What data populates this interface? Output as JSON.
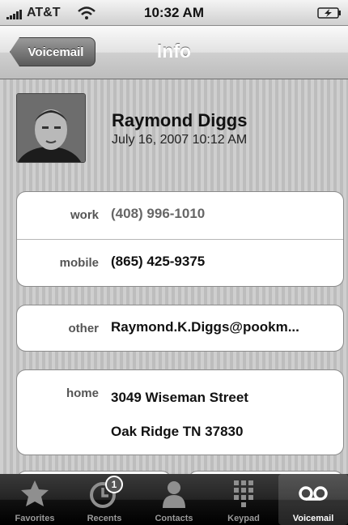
{
  "status": {
    "carrier": "AT&T",
    "time": "10:32 AM"
  },
  "nav": {
    "back_label": "Voicemail",
    "title": "Info"
  },
  "contact": {
    "name": "Raymond Diggs",
    "date": "July 16, 2007 10:12 AM"
  },
  "phones": [
    {
      "label": "work",
      "value": "(408) 996-1010"
    },
    {
      "label": "mobile",
      "value": "(865) 425-9375"
    }
  ],
  "email": {
    "label": "other",
    "value": "Raymond.K.Diggs@pookm..."
  },
  "address": {
    "label": "home",
    "line1": "3049 Wiseman Street",
    "line2": "Oak Ridge TN 37830"
  },
  "tabs": [
    {
      "label": "Favorites",
      "icon": "star-icon"
    },
    {
      "label": "Recents",
      "icon": "clock-icon",
      "badge": "1"
    },
    {
      "label": "Contacts",
      "icon": "person-icon"
    },
    {
      "label": "Keypad",
      "icon": "keypad-icon"
    },
    {
      "label": "Voicemail",
      "icon": "voicemail-icon",
      "active": true
    }
  ]
}
